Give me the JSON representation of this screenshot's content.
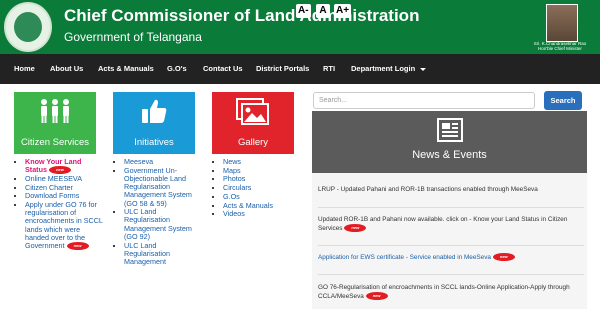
{
  "header": {
    "title": "Chief Commissioner of Land Administration",
    "subtitle": "Government of Telangana",
    "font_buttons": [
      "A-",
      "A",
      "A+"
    ],
    "cm_caption_line1": "Sri. K.Chandrasekhar Rao",
    "cm_caption_line2": "Hon'ble Chief Minister",
    "emblem_icon": "telangana-emblem",
    "colors": {
      "header_bg": "#0b7b3a",
      "nav_bg": "#222222"
    }
  },
  "nav": {
    "items": [
      "Home",
      "About Us",
      "Acts & Manuals",
      "G.O's",
      "Contact Us",
      "District Portals",
      "RTI",
      "Department Login"
    ],
    "dropdown_icon": "caret-down-icon"
  },
  "tiles": {
    "citizen": {
      "label": "Citizen Services",
      "icon": "people-icon",
      "color": "#3db54a"
    },
    "initiatives": {
      "label": "Initiatives",
      "icon": "thumbs-up-icon",
      "color": "#1a9ad6"
    },
    "gallery": {
      "label": "Gallery",
      "icon": "images-icon",
      "color": "#e1242b"
    }
  },
  "citizen_links": {
    "know_land_status": "Know Your Land Status",
    "online_meeseva": "Online MEESEVA",
    "citizen_charter": "Citizen Charter",
    "download_forms": "Download Forms",
    "go76_apply": "Apply under GO 76 for regularisation of encroachments in SCCL lands which were handed over to the Government",
    "new_badge": "new"
  },
  "initiative_links": [
    "Meeseva",
    "Government Un-Objectionable Land Regularisation Management System (GO 58 & 59)",
    "ULC Land Regularisation Management System (GO 92)",
    "ULC Land Regularisation Management"
  ],
  "gallery_links": [
    "News",
    "Maps",
    "Photos",
    "Circulars",
    "G.Os",
    "Acts & Manuals",
    "Videos"
  ],
  "search": {
    "placeholder": "Search...",
    "button": "Search"
  },
  "news": {
    "title": "News & Events",
    "icon": "newspaper-icon",
    "items": [
      "LRUP - Updated Pahani and ROR-1B transactions enabled through MeeSeva",
      "Updated ROR-1B and Pahani now available. click on - Know your Land Status in Citizen Services",
      "Application for EWS certificate - Service enabled in MeeSeva",
      "GO 76-Regularisation of encroachments in SCCL lands-Online Application-Apply through CCLA/MeeSeva"
    ]
  }
}
